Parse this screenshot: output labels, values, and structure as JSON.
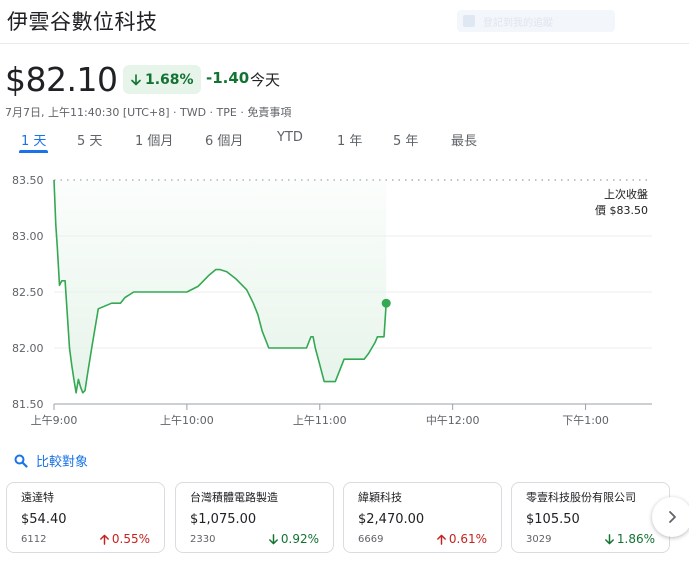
{
  "header": {
    "title": "伊雲谷數位科技",
    "follow_label": "登記到我的追蹤"
  },
  "quote": {
    "price": "$82.10",
    "percent_change": "1.68%",
    "change": "-1.40",
    "period": "今天",
    "direction": "down"
  },
  "meta": {
    "text": "7月7日, 上午11:40:30 [UTC+8] · TWD · TPE · ",
    "disclaimer": "免責事項"
  },
  "tabs": [
    {
      "label": "1 天",
      "active": true
    },
    {
      "label": "5 天",
      "active": false
    },
    {
      "label": "1 個月",
      "active": false
    },
    {
      "label": "6 個月",
      "active": false
    },
    {
      "label": "YTD",
      "active": false
    },
    {
      "label": "1 年",
      "active": false
    },
    {
      "label": "5 年",
      "active": false
    },
    {
      "label": "最長",
      "active": false
    }
  ],
  "chart_data": {
    "type": "area",
    "x_axis_labels": [
      "上午9:00",
      "上午10:00",
      "上午11:00",
      "中午12:00",
      "下午1:00"
    ],
    "x_range_minutes": [
      540,
      810
    ],
    "x_tick_minutes": [
      540,
      600,
      660,
      720,
      780
    ],
    "y_ticks": [
      "83.50",
      "83.00",
      "82.50",
      "82.00",
      "81.50"
    ],
    "y_tick_values": [
      83.5,
      83.0,
      82.5,
      82.0,
      81.5
    ],
    "ylim": [
      81.5,
      83.5
    ],
    "previous_close": {
      "label_line1": "上次收盤",
      "label_line2": "價 $83.50",
      "value": 83.5
    },
    "line_color": "#34a853",
    "fill_color": "#e6f4ea",
    "series": [
      {
        "x_minutes": [
          540.0,
          540.8,
          541.5,
          542.5,
          543.5,
          545,
          546,
          547,
          548,
          549,
          550,
          551,
          552,
          553,
          554,
          555,
          557,
          560,
          566,
          570,
          572,
          576,
          580,
          590,
          600,
          605,
          610,
          613,
          615,
          618,
          622,
          627,
          630,
          632,
          634,
          637,
          640,
          645,
          650,
          654,
          656,
          657,
          658,
          660,
          662,
          667,
          671,
          674,
          680,
          682,
          685,
          686,
          689,
          690
        ],
        "y_values": [
          83.5,
          83.1,
          82.9,
          82.56,
          82.6,
          82.6,
          82.3,
          82.0,
          81.85,
          81.72,
          81.6,
          81.72,
          81.65,
          81.6,
          81.62,
          81.75,
          82.0,
          82.35,
          82.4,
          82.4,
          82.45,
          82.5,
          82.5,
          82.5,
          82.5,
          82.55,
          82.65,
          82.7,
          82.7,
          82.68,
          82.62,
          82.52,
          82.4,
          82.3,
          82.15,
          82.0,
          82.0,
          82.0,
          82.0,
          82.0,
          82.1,
          82.1,
          82.0,
          81.85,
          81.7,
          81.7,
          81.9,
          81.9,
          81.9,
          81.95,
          82.05,
          82.1,
          82.1,
          82.4
        ]
      }
    ]
  },
  "compare": {
    "label": "比較對象"
  },
  "cards": [
    {
      "name": "遠達特",
      "price": "$54.40",
      "code": "6112",
      "change": "0.55%",
      "direction": "up"
    },
    {
      "name": "台灣積體電路製造",
      "price": "$1,075.00",
      "code": "2330",
      "change": "0.92%",
      "direction": "down"
    },
    {
      "name": "緯穎科技",
      "price": "$2,470.00",
      "code": "6669",
      "change": "0.61%",
      "direction": "up"
    },
    {
      "name": "零壹科技股份有限公司",
      "price": "$105.50",
      "code": "3029",
      "change": "1.86%",
      "direction": "down"
    }
  ],
  "icons": {
    "compare": "search-icon",
    "next": "chevron-right-icon",
    "badge": "arrow-down-icon"
  }
}
